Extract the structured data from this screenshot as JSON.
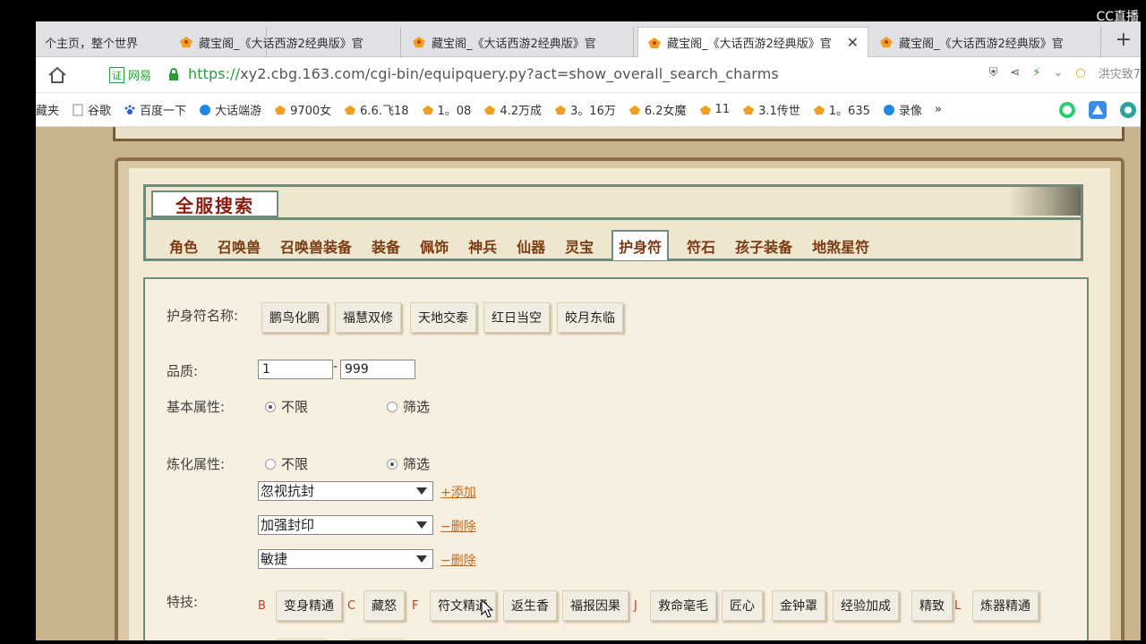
{
  "watermark": "CC直播",
  "tabs": [
    {
      "label": "个主页，整个世界",
      "active": false
    },
    {
      "label": "藏宝阁_《大话西游2经典版》官",
      "active": false
    },
    {
      "label": "藏宝阁_《大话西游2经典版》官",
      "active": false
    },
    {
      "label": "藏宝阁_《大话西游2经典版》官",
      "active": true
    },
    {
      "label": "藏宝阁_《大话西游2经典版》官",
      "active": false
    }
  ],
  "addressbar": {
    "cert_label": "证",
    "cert_owner": "网易",
    "url_scheme": "https://",
    "url_rest": "xy2.cbg.163.com/cgi-bin/equipquery.py?act=show_overall_search_charms",
    "search_hint": "洪灾致7"
  },
  "bookmarks": [
    "藏夹",
    "谷歌",
    "百度一下",
    "大话端游",
    "9700女",
    "6.6.飞18",
    "1。08",
    "4.2万成",
    "3。16万",
    "6.2女魔",
    "11",
    "3.1传世",
    "1。635",
    "录像",
    "»"
  ],
  "page": {
    "title": "全服搜索",
    "nav": [
      "角色",
      "召唤兽",
      "召唤兽装备",
      "装备",
      "佩饰",
      "神兵",
      "仙器",
      "灵宝",
      "护身符",
      "符石",
      "孩子装备",
      "地煞星符"
    ],
    "nav_active_index": 8,
    "form": {
      "name_label": "护身符名称:",
      "names": [
        "鹏鸟化鹏",
        "福慧双修",
        "天地交泰",
        "红日当空",
        "皎月东临"
      ],
      "quality_label": "品质:",
      "quality_min": "1",
      "quality_max": "999",
      "basic_label": "基本属性:",
      "refine_label": "炼化属性:",
      "opt_any": "不限",
      "opt_filter": "筛选",
      "refine_selects": [
        "忽视抗封",
        "加强封印",
        "敏捷"
      ],
      "add_link": "+添加",
      "remove_link": "−删除",
      "skill_label": "特技:",
      "skills": [
        {
          "letter": "B",
          "items": [
            "变身精通"
          ]
        },
        {
          "letter": "C",
          "items": [
            "藏怒"
          ]
        },
        {
          "letter": "F",
          "items": [
            "符文精通",
            "返生香",
            "福报因果"
          ]
        },
        {
          "letter": "J",
          "items": [
            "救命毫毛",
            "匠心",
            "金钟罩",
            "经验加成",
            "精致"
          ]
        },
        {
          "letter": "L",
          "items": [
            "炼器精通"
          ]
        }
      ]
    }
  },
  "colors": {
    "accent_red": "#8a1c12",
    "nav_brown": "#7b3b12",
    "frame_green": "#6f8c7a",
    "link_orange": "#c06a1b"
  }
}
